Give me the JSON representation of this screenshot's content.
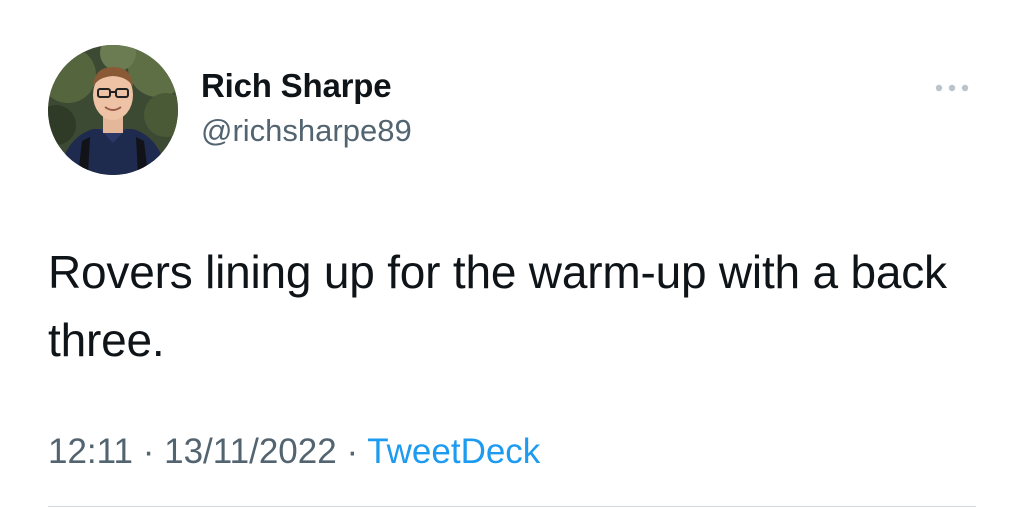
{
  "tweet": {
    "author": {
      "display_name": "Rich Sharpe",
      "handle": "@richsharpe89",
      "avatar_icon": "profile-photo"
    },
    "more_icon": "ellipsis-icon",
    "text": "Rovers lining up for the warm-up with a back three.",
    "meta": {
      "time": "12:11",
      "separator": "·",
      "date": "13/11/2022",
      "source": "TweetDeck"
    }
  },
  "colors": {
    "text_primary": "#0f1419",
    "text_secondary": "#536471",
    "accent": "#1d9bf0",
    "divider": "#cfd9de"
  }
}
